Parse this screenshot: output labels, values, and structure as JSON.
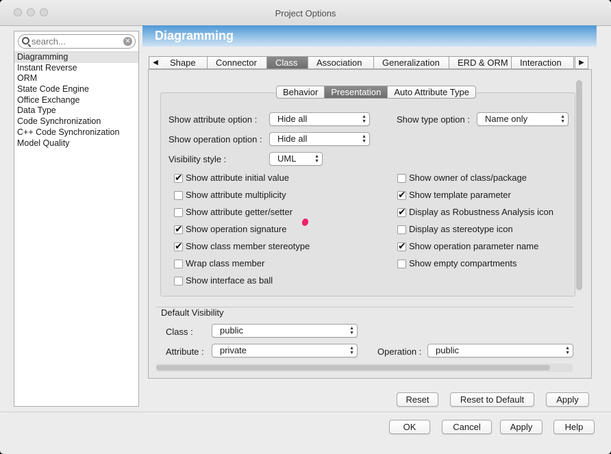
{
  "window": {
    "title": "Project Options"
  },
  "search": {
    "placeholder": "search..."
  },
  "sidebar": {
    "items": [
      "Diagramming",
      "Instant Reverse",
      "ORM",
      "State Code Engine",
      "Office Exchange",
      "Data Type",
      "Code Synchronization",
      "C++ Code Synchronization",
      "Model Quality"
    ],
    "selected": "Diagramming"
  },
  "header": {
    "title": "Diagramming",
    "color": "#4f98d6"
  },
  "tabs": [
    "Shape",
    "Connector",
    "Class",
    "Association",
    "Generalization",
    "ERD & ORM",
    "Interaction"
  ],
  "active_tab": "Class",
  "subtabs": [
    "Behavior",
    "Presentation",
    "Auto Attribute Type"
  ],
  "active_subtab": "Presentation",
  "form": {
    "show_attribute_option": {
      "label": "Show attribute option :",
      "value": "Hide all"
    },
    "show_type_option": {
      "label": "Show type option :",
      "value": "Name only"
    },
    "show_operation_option": {
      "label": "Show operation option :",
      "value": "Hide all"
    },
    "visibility_style": {
      "label": "Visibility style :",
      "value": "UML"
    }
  },
  "checkboxes_left": [
    {
      "label": "Show attribute initial value",
      "checked": true
    },
    {
      "label": "Show attribute multiplicity",
      "checked": false
    },
    {
      "label": "Show attribute getter/setter",
      "checked": false
    },
    {
      "label": "Show operation signature",
      "checked": true
    },
    {
      "label": "Show class member stereotype",
      "checked": true
    },
    {
      "label": "Wrap class member",
      "checked": false
    },
    {
      "label": "Show interface as ball",
      "checked": false
    }
  ],
  "checkboxes_right": [
    {
      "label": "Show owner of class/package",
      "checked": false
    },
    {
      "label": "Show template parameter",
      "checked": true
    },
    {
      "label": "Display as Robustness Analysis icon",
      "checked": true
    },
    {
      "label": "Display as stereotype icon",
      "checked": false
    },
    {
      "label": "Show operation parameter name",
      "checked": true
    },
    {
      "label": "Show empty compartments",
      "checked": false
    }
  ],
  "default_visibility": {
    "title": "Default Visibility",
    "class": {
      "label": "Class :",
      "value": "public"
    },
    "attribute": {
      "label": "Attribute :",
      "value": "private"
    },
    "operation": {
      "label": "Operation :",
      "value": "public"
    }
  },
  "panel_buttons": {
    "reset": "Reset",
    "reset_default": "Reset to Default",
    "apply": "Apply"
  },
  "dialog_buttons": {
    "ok": "OK",
    "cancel": "Cancel",
    "apply": "Apply",
    "help": "Help"
  }
}
